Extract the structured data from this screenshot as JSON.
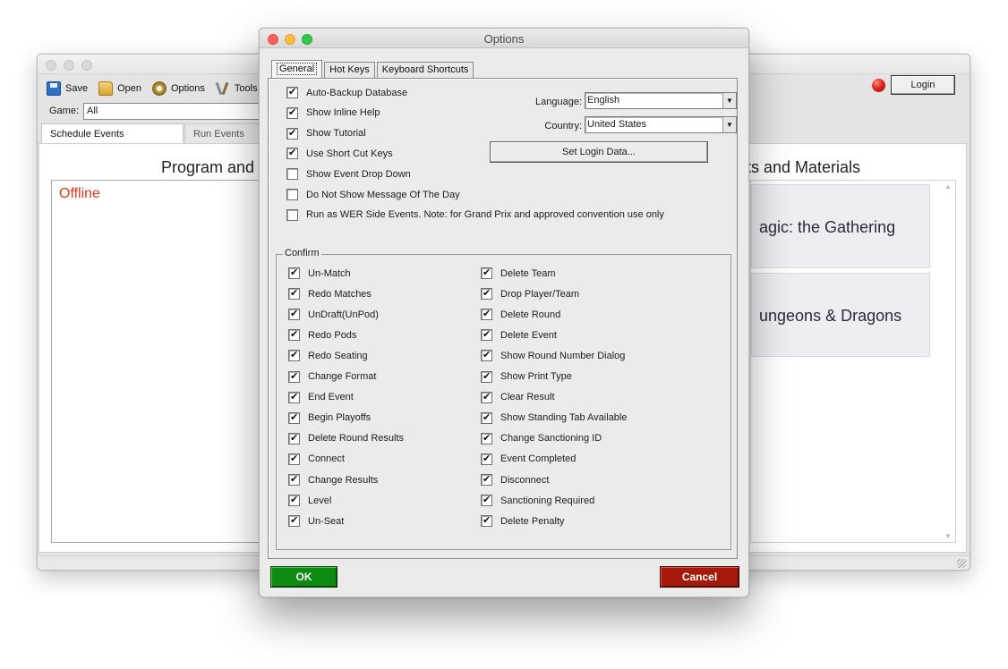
{
  "main_window": {
    "toolbar": {
      "save": "Save",
      "open": "Open",
      "options": "Options",
      "tools": "Tools"
    },
    "login_button": "Login",
    "game_label": "Game:",
    "game_value": "All",
    "tabs": [
      "Schedule Events",
      "Run Events"
    ],
    "program_title": "Program and",
    "materials_title": "ts and Materials",
    "status_text": "Offline",
    "materials": [
      "agic: the Gathering",
      "ungeons & Dragons"
    ]
  },
  "dialog": {
    "title": "Options",
    "tabs": [
      "General",
      "Hot Keys",
      "Keyboard Shortcuts"
    ],
    "general_options": [
      {
        "label": "Auto-Backup Database",
        "checked": true
      },
      {
        "label": "Show Inline Help",
        "checked": true
      },
      {
        "label": "Show Tutorial",
        "checked": true
      },
      {
        "label": "Use Short Cut Keys",
        "checked": true
      },
      {
        "label": "Show Event Drop Down",
        "checked": false
      },
      {
        "label": "Do Not Show Message Of The Day",
        "checked": false
      },
      {
        "label": "Run as WER Side Events. Note: for Grand Prix and approved convention use only",
        "checked": false
      }
    ],
    "language_label": "Language:",
    "language_value": "English",
    "country_label": "Country:",
    "country_value": "United States",
    "set_login_button": "Set Login Data...",
    "confirm_legend": "Confirm",
    "confirm_left": [
      {
        "label": "Un-Match",
        "checked": true
      },
      {
        "label": "Redo Matches",
        "checked": true
      },
      {
        "label": "UnDraft(UnPod)",
        "checked": true
      },
      {
        "label": "Redo Pods",
        "checked": true
      },
      {
        "label": "Redo Seating",
        "checked": true
      },
      {
        "label": "Change Format",
        "checked": true
      },
      {
        "label": "End Event",
        "checked": true
      },
      {
        "label": "Begin Playoffs",
        "checked": true
      },
      {
        "label": "Delete Round Results",
        "checked": true
      },
      {
        "label": "Connect",
        "checked": true
      },
      {
        "label": "Change Results",
        "checked": true
      },
      {
        "label": "Level",
        "checked": true
      },
      {
        "label": "Un-Seat",
        "checked": true
      }
    ],
    "confirm_right": [
      {
        "label": "Delete Team",
        "checked": true
      },
      {
        "label": "Drop Player/Team",
        "checked": true
      },
      {
        "label": "Delete Round",
        "checked": true
      },
      {
        "label": "Delete Event",
        "checked": true
      },
      {
        "label": "Show Round Number Dialog",
        "checked": true
      },
      {
        "label": "Show Print Type",
        "checked": true
      },
      {
        "label": "Clear Result",
        "checked": true
      },
      {
        "label": "Show Standing Tab Available",
        "checked": true
      },
      {
        "label": "Change Sanctioning ID",
        "checked": true
      },
      {
        "label": "Event Completed",
        "checked": true
      },
      {
        "label": "Disconnect",
        "checked": true
      },
      {
        "label": "Sanctioning Required",
        "checked": true
      },
      {
        "label": "Delete Penalty",
        "checked": true
      }
    ],
    "ok_button": "OK",
    "cancel_button": "Cancel"
  }
}
